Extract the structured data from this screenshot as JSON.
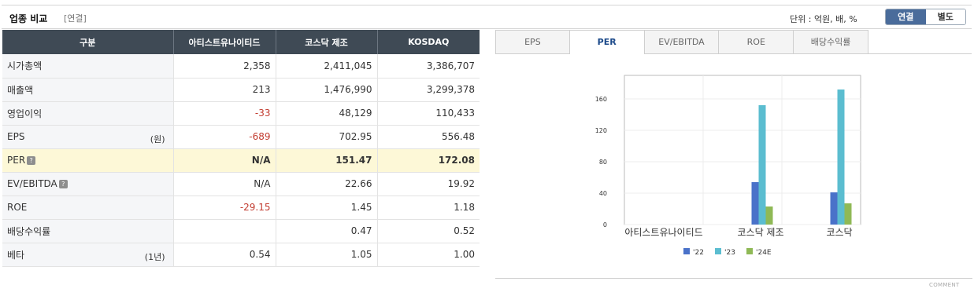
{
  "header": {
    "title": "업종 비교",
    "subtitle": "[연결]",
    "unit": "단위 : 억원, 배, %"
  },
  "toggle": {
    "consolidated": "연결",
    "separate": "별도"
  },
  "table": {
    "columns": [
      "구분",
      "아티스트유나이티드",
      "코스닥 제조",
      "KOSDAQ"
    ],
    "rows": [
      {
        "label": "시가총액",
        "unit": "",
        "values": [
          "2,358",
          "2,411,045",
          "3,386,707"
        ]
      },
      {
        "label": "매출액",
        "unit": "",
        "values": [
          "213",
          "1,476,990",
          "3,299,378"
        ]
      },
      {
        "label": "영업이익",
        "unit": "",
        "values": [
          "-33",
          "48,129",
          "110,433"
        ]
      },
      {
        "label": "EPS",
        "unit": "(원)",
        "values": [
          "-689",
          "702.95",
          "556.48"
        ]
      },
      {
        "label": "PER",
        "unit": "",
        "values": [
          "N/A",
          "151.47",
          "172.08"
        ]
      },
      {
        "label": "EV/EBITDA",
        "unit": "",
        "values": [
          "N/A",
          "22.66",
          "19.92"
        ]
      },
      {
        "label": "ROE",
        "unit": "",
        "values": [
          "-29.15",
          "1.45",
          "1.18"
        ]
      },
      {
        "label": "배당수익률",
        "unit": "",
        "values": [
          "",
          "0.47",
          "0.52"
        ]
      },
      {
        "label": "베타",
        "unit": "(1년)",
        "values": [
          "0.54",
          "1.05",
          "1.00"
        ]
      }
    ]
  },
  "tabs": [
    "EPS",
    "PER",
    "EV/EBITDA",
    "ROE",
    "배당수익률"
  ],
  "active_tab": "PER",
  "chart_data": {
    "type": "bar",
    "categories": [
      "아티스트유나이티드",
      "코스닥 제조",
      "코스닥"
    ],
    "series": [
      {
        "name": "'22",
        "color": "#4a72c9",
        "values": [
          0,
          54,
          41
        ]
      },
      {
        "name": "'23",
        "color": "#5bbdd0",
        "values": [
          0,
          152,
          172
        ]
      },
      {
        "name": "'24E",
        "color": "#8fb956",
        "values": [
          0,
          23,
          27
        ]
      }
    ],
    "yticks": [
      "0",
      "40",
      "80",
      "120",
      "160"
    ],
    "ylim": [
      0,
      190
    ],
    "grid": true,
    "legend": "bottom"
  },
  "footer": {
    "comment": "COMMENT"
  }
}
